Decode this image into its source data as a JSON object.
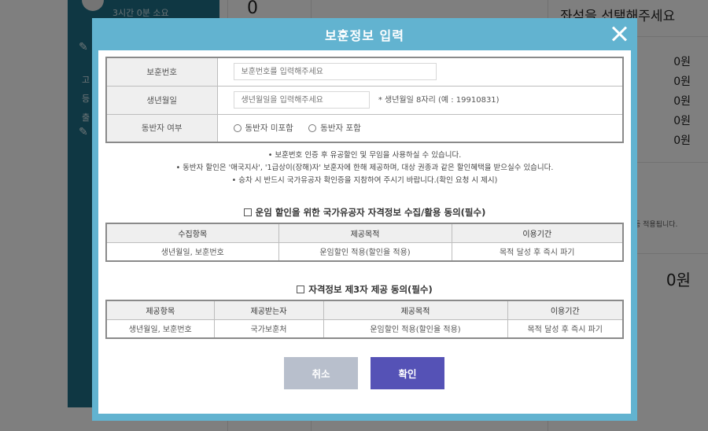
{
  "background": {
    "duration": "3시간 0분 소요",
    "count": "0",
    "right_title": "좌석을 선택해주세요",
    "prices": [
      "0원",
      "0원",
      "0원",
      "0원",
      "0원"
    ],
    "note": "등 적용됩니다.",
    "total": "0원",
    "side_texts": [
      "고",
      "등",
      "출"
    ]
  },
  "modal": {
    "title": "보훈정보 입력",
    "form": {
      "number_label": "보훈번호",
      "number_placeholder": "보훈번호를 입력해주세요",
      "birth_label": "생년월일",
      "birth_placeholder": "생년월일을 입력해주세요",
      "birth_hint": "* 생년월일 8자리 (예 : 19910831)",
      "companion_label": "동반자 여부",
      "companion_options": [
        "동반자 미포함",
        "동반자 포함"
      ]
    },
    "notices": [
      "• 보훈번호 인증 후 유공할인 및 무임을 사용하실 수 있습니다.",
      "• 동반자 할인은 '애국지사', '1급상이(장해)자' 보훈자에 한해 제공하며, 대상 권종과 같은 할인혜택을 받으실수 있습니다.",
      "• 승차 시 반드시 국가유공자 확인증을 지참하여 주시기 바랍니다.(확인 요청 시 제시)"
    ],
    "consent1": {
      "title": "운임 할인을 위한 국가유공자 자격정보 수집/활용 동의(필수)",
      "headers": [
        "수집항목",
        "제공목적",
        "이용기간"
      ],
      "row": [
        "생년월일, 보훈번호",
        "운임할인 적용(할인율 적용)",
        "목적 달성 후 즉시 파기"
      ]
    },
    "consent2": {
      "title": "자격정보 제3자 제공 동의(필수)",
      "headers": [
        "제공항목",
        "제공받는자",
        "제공목적",
        "이용기간"
      ],
      "row": [
        "생년월일, 보훈번호",
        "국가보훈처",
        "운임할인 적용(할인율 적용)",
        "목적 달성 후 즉시 파기"
      ]
    },
    "buttons": {
      "cancel": "취소",
      "confirm": "확인"
    }
  }
}
